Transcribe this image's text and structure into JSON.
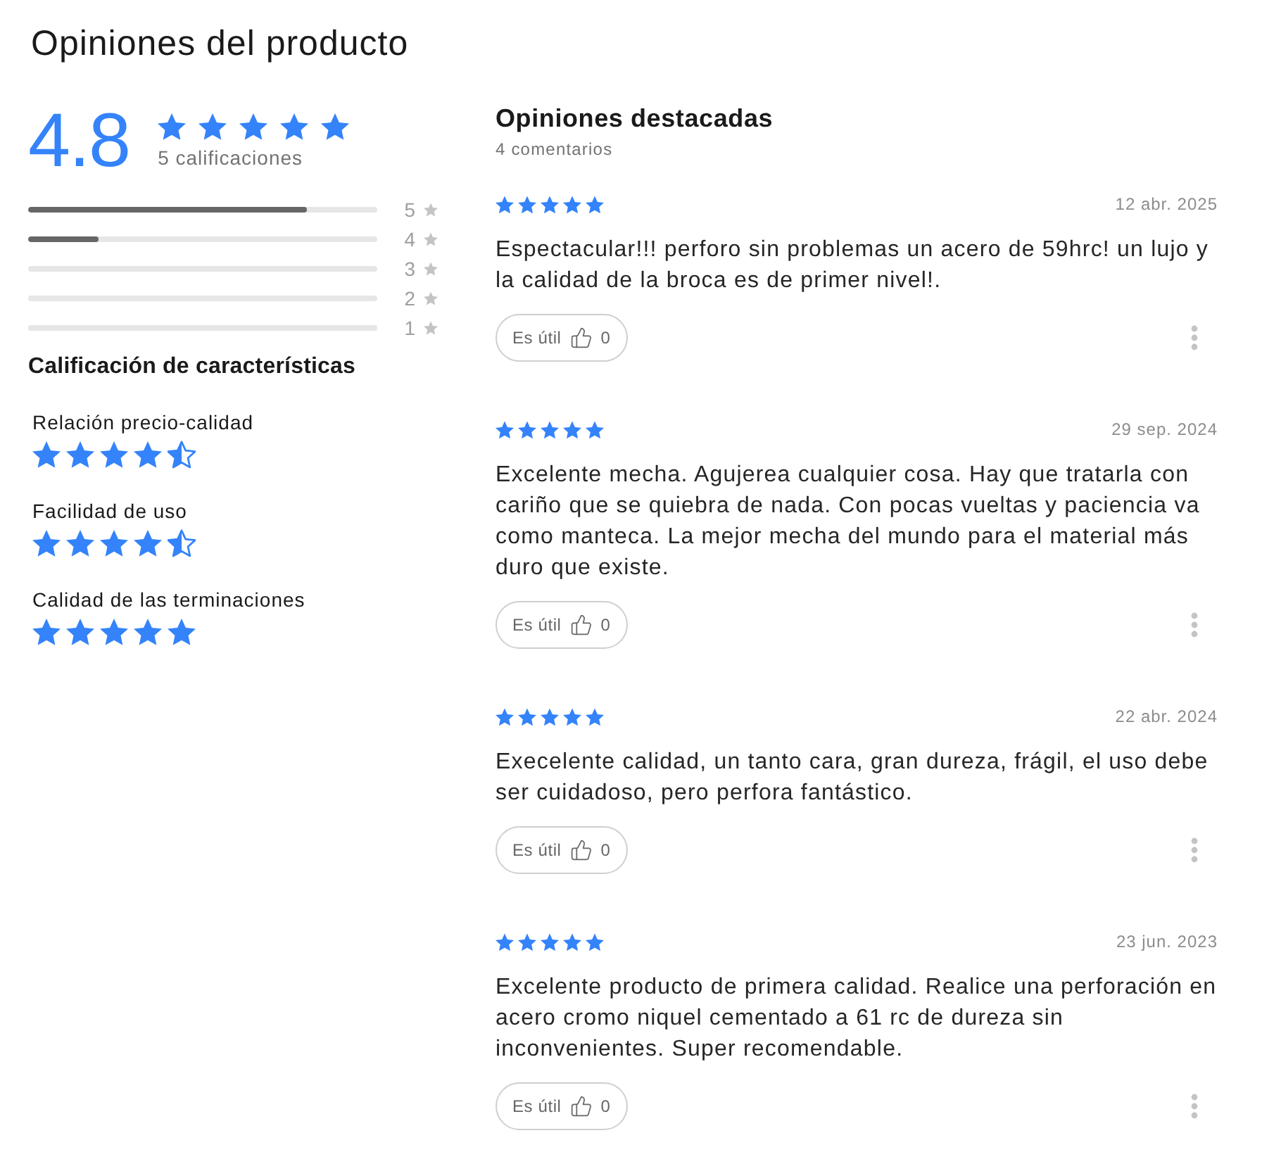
{
  "title": "Opiniones del producto",
  "summary": {
    "average": "4.8",
    "stars": 5,
    "count_label": "5 calificaciones"
  },
  "histogram": [
    {
      "label": "5",
      "level": 0.8
    },
    {
      "label": "4",
      "level": 0.2
    },
    {
      "label": "3",
      "level": 0
    },
    {
      "label": "2",
      "level": 0
    },
    {
      "label": "1",
      "level": 0
    }
  ],
  "features": {
    "title": "Calificación de características",
    "items": [
      {
        "label": "Relación precio-calidad",
        "stars": 4.5
      },
      {
        "label": "Facilidad de uso",
        "stars": 4.5
      },
      {
        "label": "Calidad de las terminaciones",
        "stars": 5
      }
    ]
  },
  "reviews": {
    "title": "Opiniones destacadas",
    "count": "4 comentarios",
    "items": [
      {
        "stars": 5,
        "date": "12 abr. 2025",
        "text": "Espectacular!!! perforo sin problemas un acero de 59hrc! un lujo y la calidad de la broca es de primer nivel!.",
        "helpful_label": "Es útil",
        "helpful_count": "0"
      },
      {
        "stars": 5,
        "date": "29 sep. 2024",
        "text": "Excelente mecha. Agujerea cualquier cosa. Hay que tratarla con cariño que se quiebra de nada. Con pocas vueltas y paciencia va como manteca. La mejor mecha del mundo para el material más duro que existe.",
        "helpful_label": "Es útil",
        "helpful_count": "0"
      },
      {
        "stars": 5,
        "date": "22 abr. 2024",
        "text": "Execelente calidad, un tanto cara, gran dureza, frágil, el uso debe ser cuidadoso, pero perfora fantástico.",
        "helpful_label": "Es útil",
        "helpful_count": "0"
      },
      {
        "stars": 5,
        "date": "23 jun. 2023",
        "text": "Excelente producto de primera calidad. Realice una perforación en acero cromo niquel cementado a 61 rc de dureza sin inconvenientes. Super recomendable.",
        "helpful_label": "Es útil",
        "helpful_count": "0"
      }
    ]
  }
}
